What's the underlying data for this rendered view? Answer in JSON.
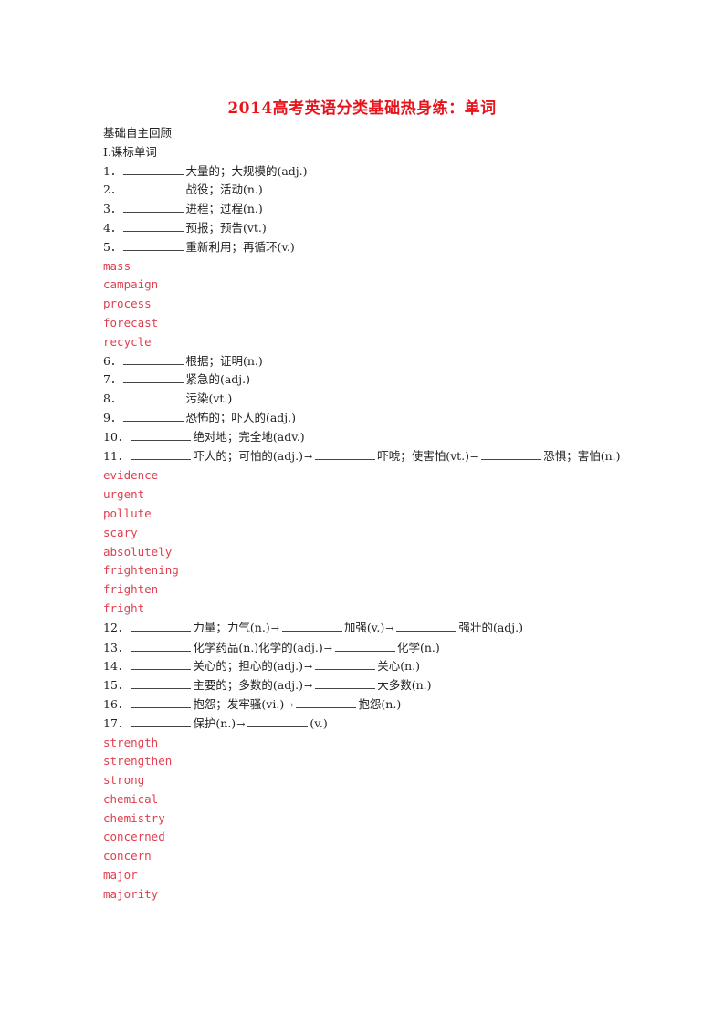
{
  "document": {
    "title": "2014高考英语分类基础热身练：单词",
    "section_heading": "基础自主回顾",
    "subsection_heading": "Ⅰ.课标单词",
    "arrow": "→",
    "questions_group1": [
      {
        "num": "1．",
        "parts": [
          "大量的；大规模的(adj.)"
        ]
      },
      {
        "num": "2．",
        "parts": [
          "战役；活动(n.)"
        ]
      },
      {
        "num": "3．",
        "parts": [
          "进程；过程(n.)"
        ]
      },
      {
        "num": "4．",
        "parts": [
          "预报；预告(vt.)"
        ]
      },
      {
        "num": "5．",
        "parts": [
          "重新利用；再循环(v.)"
        ]
      }
    ],
    "answers_group1": [
      "mass",
      "campaign",
      "process",
      "forecast",
      "recycle"
    ],
    "questions_group2": [
      {
        "num": "6．",
        "parts": [
          "根据；证明(n.)"
        ]
      },
      {
        "num": "7．",
        "parts": [
          "紧急的(adj.)"
        ]
      },
      {
        "num": "8．",
        "parts": [
          "污染(vt.)"
        ]
      },
      {
        "num": "9．",
        "parts": [
          "恐怖的；吓人的(adj.)"
        ]
      },
      {
        "num": "10．",
        "parts": [
          "绝对地；完全地(adv.)"
        ]
      },
      {
        "num": "11．",
        "parts": [
          "吓人的；可怕的(adj.)",
          "吓唬；使害怕(vt.)",
          "恐惧；害怕(n.)"
        ]
      }
    ],
    "answers_group2": [
      "evidence",
      "urgent",
      "pollute",
      "scary",
      "absolutely",
      "frightening",
      "frighten",
      "fright"
    ],
    "questions_group3": [
      {
        "num": "12．",
        "parts": [
          "力量；力气(n.)",
          "加强(v.)",
          "强壮的(adj.)"
        ]
      },
      {
        "num": "13．",
        "parts": [
          "化学药品(n.)化学的(adj.)",
          "化学(n.)"
        ]
      },
      {
        "num": "14．",
        "parts": [
          "关心的；担心的(adj.)",
          "关心(n.)"
        ]
      },
      {
        "num": "15．",
        "parts": [
          "主要的；多数的(adj.)",
          "大多数(n.)"
        ]
      },
      {
        "num": "16．",
        "parts": [
          "抱怨；发牢骚(vi.)",
          "抱怨(n.)"
        ]
      },
      {
        "num": "17．",
        "parts": [
          "保护(n.)",
          "(v.)"
        ]
      }
    ],
    "answers_group3": [
      "strength",
      "strengthen",
      "strong",
      "chemical",
      "chemistry",
      "concerned",
      "concern",
      "major",
      "majority"
    ]
  },
  "colors": {
    "title": "#e8141c",
    "answer": "#e04050",
    "text": "#222222"
  }
}
